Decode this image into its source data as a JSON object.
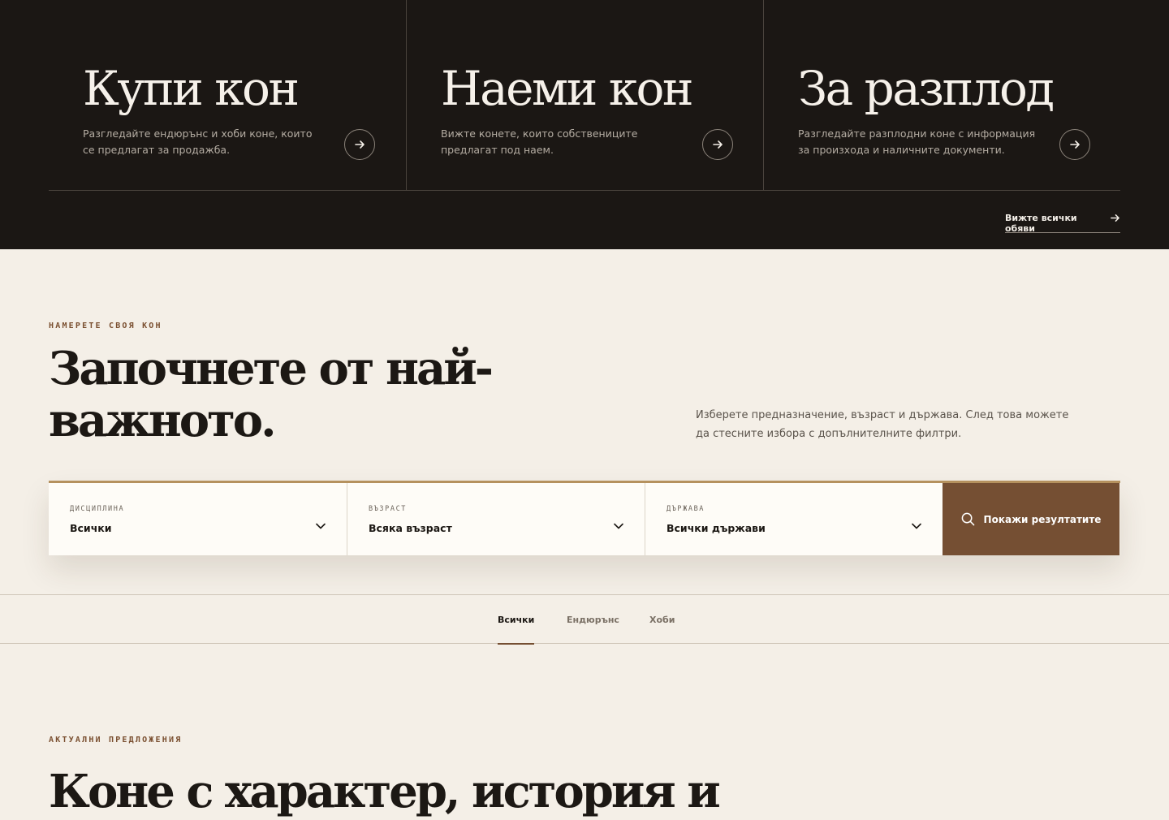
{
  "categories": [
    {
      "title": "Купи кон",
      "description": "Разгледайте ендюрънс и хоби коне, които се предлагат за продажба."
    },
    {
      "title": "Наеми кон",
      "description": "Вижте конете, които собствениците предлагат под наем."
    },
    {
      "title": "За разплод",
      "description": "Разгледайте разплодни коне с информация за произхода и наличните документи."
    }
  ],
  "see_all_label": "Вижте всички обяви",
  "search_section": {
    "eyebrow": "НАМЕРЕТЕ СВОЯ КОН",
    "heading": "Започнете от най-важното.",
    "lead": "Изберете предназначение, възраст и държава. След това можете да стесните избора с допълнителните филтри.",
    "fields": [
      {
        "label": "ДИСЦИПЛИНА",
        "value": "Всички"
      },
      {
        "label": "ВЪЗРАСТ",
        "value": "Всяка възраст"
      },
      {
        "label": "ДЪРЖАВА",
        "value": "Всички държави"
      }
    ],
    "submit_label": "Покажи резултатите"
  },
  "tabs": [
    {
      "label": "Всички",
      "active": true
    },
    {
      "label": "Ендюрънс",
      "active": false
    },
    {
      "label": "Хоби",
      "active": false
    }
  ],
  "offers_section": {
    "eyebrow": "АКТУАЛНИ ПРЕДЛОЖЕНИЯ",
    "heading": "Коне с характер, история и"
  },
  "colors": {
    "dark_bg": "#1b1714",
    "page_bg": "#f4efe7",
    "accent": "#754f33",
    "gold_rule": "#b5915e"
  }
}
